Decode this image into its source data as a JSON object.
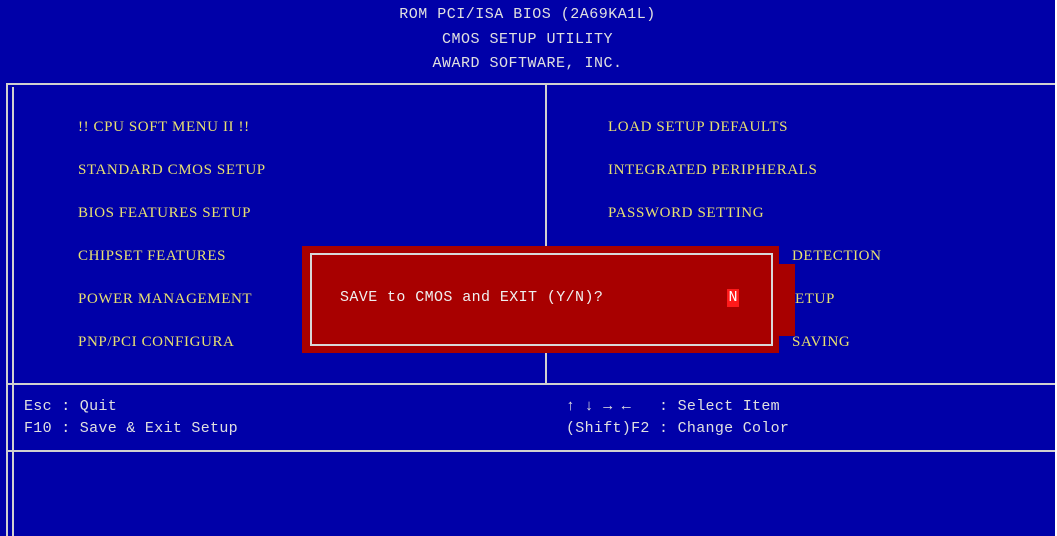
{
  "header": {
    "line1": "ROM PCI/ISA BIOS (2A69KA1L)",
    "line2": "CMOS SETUP UTILITY",
    "line3": "AWARD SOFTWARE, INC."
  },
  "menu": {
    "left": [
      "!! CPU SOFT MENU II !!",
      "STANDARD CMOS SETUP",
      "BIOS FEATURES SETUP",
      "CHIPSET FEATURES",
      "POWER MANAGEMENT",
      "PNP/PCI CONFIGURA"
    ],
    "right": [
      "LOAD SETUP DEFAULTS",
      "INTEGRATED PERIPHERALS",
      "PASSWORD SETTING",
      "DETECTION",
      "ETUP",
      "SAVING"
    ]
  },
  "help": {
    "esc": "Esc : Quit",
    "f10": "F10 : Save & Exit Setup",
    "arrows": "↑ ↓ → ←   : Select Item",
    "shift_f2": "(Shift)F2 : Change Color"
  },
  "dialog": {
    "prompt": "SAVE to CMOS and EXIT (Y/N)?",
    "answer": "N"
  },
  "colors": {
    "background": "#0000a8",
    "menu_text": "#e8e070",
    "dialog_bg": "#a80000",
    "cursor": "#ff1a1a"
  }
}
